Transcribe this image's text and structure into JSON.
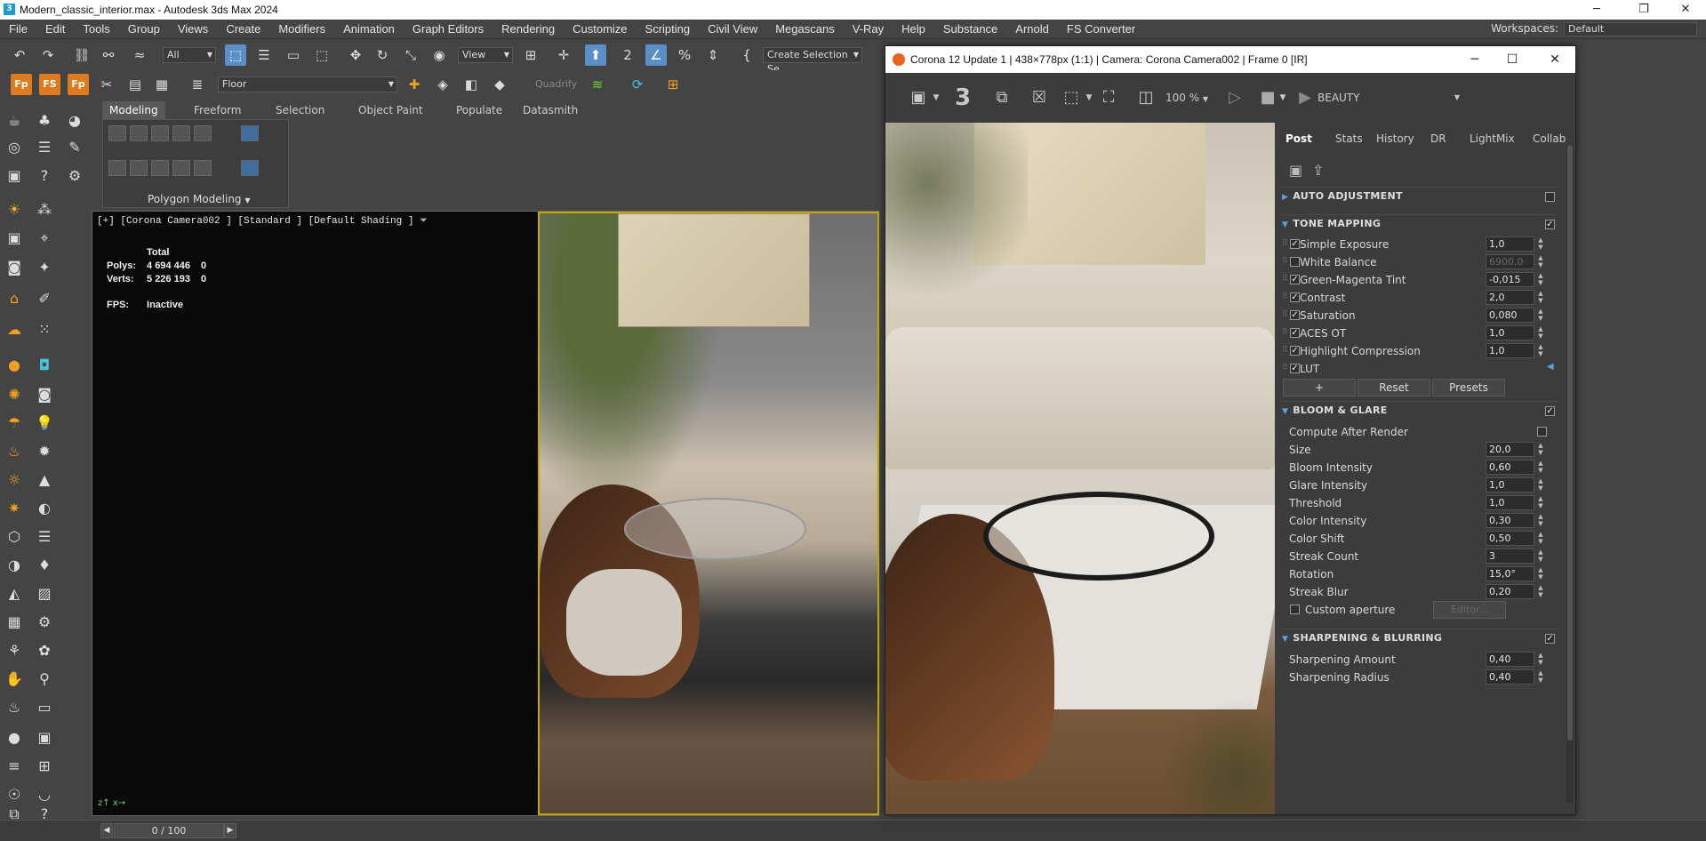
{
  "window": {
    "title": "Modern_classic_interior.max - Autodesk 3ds Max 2024",
    "minimize": "─",
    "maximize": "❐",
    "close": "✕"
  },
  "menu": {
    "items": [
      "File",
      "Edit",
      "Tools",
      "Group",
      "Views",
      "Create",
      "Modifiers",
      "Animation",
      "Graph Editors",
      "Rendering",
      "Customize",
      "Scripting",
      "Civil View",
      "Megascans",
      "V-Ray",
      "Help",
      "Substance",
      "Arnold",
      "FS Converter"
    ],
    "workspaces_label": "Workspaces:",
    "workspaces_value": "Default"
  },
  "toolbar": {
    "filter_value": "All",
    "view_value": "View",
    "selection_set_value": "Create Selection Se",
    "layer_value": "Floor",
    "quadrify_label": "Quadrify"
  },
  "ribbon": {
    "tabs": [
      "Modeling",
      "Freeform",
      "Selection",
      "Object Paint",
      "Populate",
      "Datasmith"
    ],
    "panel_label": "Polygon Modeling"
  },
  "viewport": {
    "label": "[+] [Corona Camera002 ] [Standard ] [Default Shading ]",
    "stats_header": "Total",
    "polys_label": "Polys:",
    "polys_total": "4 694 446",
    "polys_sel": "0",
    "verts_label": "Verts:",
    "verts_total": "5 226 193",
    "verts_sel": "0",
    "fps_label": "FPS:",
    "fps_value": "Inactive"
  },
  "timeslider": {
    "value": "0 / 100"
  },
  "vfb": {
    "title": "Corona 12 Update 1 | 438×778px (1:1) | Camera: Corona Camera002 | Frame 0 [IR]",
    "zoom": "100 %",
    "render_pass": "BEAUTY",
    "tabs": [
      "Post",
      "Stats",
      "History",
      "DR",
      "LightMix",
      "Collab"
    ],
    "sections": {
      "auto_adjustment": "AUTO ADJUSTMENT",
      "tone_mapping": "TONE MAPPING",
      "bloom_glare": "BLOOM & GLARE",
      "sharpening": "SHARPENING & BLURRING"
    },
    "tone_mapping": [
      {
        "label": "Simple Exposure",
        "value": "1,0",
        "checked": true
      },
      {
        "label": "White Balance",
        "value": "6900,0",
        "checked": false
      },
      {
        "label": "Green-Magenta Tint",
        "value": "-0,015",
        "checked": true
      },
      {
        "label": "Contrast",
        "value": "2,0",
        "checked": true
      },
      {
        "label": "Saturation",
        "value": "0,080",
        "checked": true
      },
      {
        "label": "ACES OT",
        "value": "1,0",
        "checked": true
      },
      {
        "label": "Highlight Compression",
        "value": "1,0",
        "checked": true
      },
      {
        "label": "LUT",
        "value": "",
        "checked": true
      }
    ],
    "buttons": {
      "add": "+",
      "reset": "Reset",
      "presets": "Presets",
      "editor": "Editor..."
    },
    "compute_after_render": "Compute After Render",
    "bloom": [
      {
        "label": "Size",
        "value": "20,0"
      },
      {
        "label": "Bloom Intensity",
        "value": "0,60"
      },
      {
        "label": "Glare Intensity",
        "value": "1,0"
      },
      {
        "label": "Threshold",
        "value": "1,0"
      },
      {
        "label": "Color Intensity",
        "value": "0,30"
      },
      {
        "label": "Color Shift",
        "value": "0,50"
      },
      {
        "label": "Streak Count",
        "value": "3"
      },
      {
        "label": "Rotation",
        "value": "15,0°"
      },
      {
        "label": "Streak Blur",
        "value": "0,20"
      }
    ],
    "custom_aperture": "Custom aperture",
    "sharpening": [
      {
        "label": "Sharpening Amount",
        "value": "0,40"
      },
      {
        "label": "Sharpening Radius",
        "value": "0,40"
      }
    ]
  }
}
